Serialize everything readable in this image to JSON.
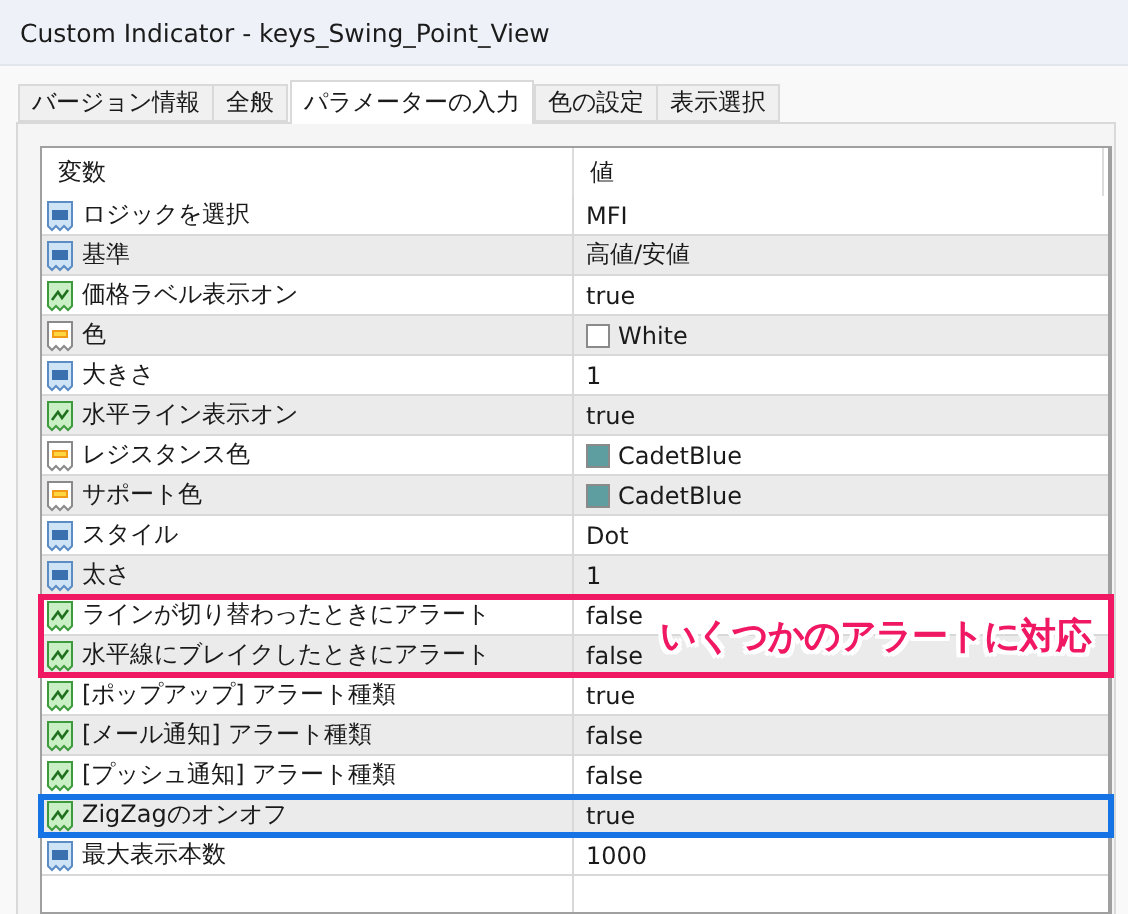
{
  "window": {
    "title": "Custom Indicator - keys_Swing_Point_View"
  },
  "tabs": [
    {
      "label": "バージョン情報",
      "selected": false
    },
    {
      "label": "全般",
      "selected": false
    },
    {
      "label": "パラメーターの入力",
      "selected": true
    },
    {
      "label": "色の設定",
      "selected": false
    },
    {
      "label": "表示選択",
      "selected": false
    }
  ],
  "table": {
    "columns": [
      "変数",
      "値"
    ],
    "groups": [
      {
        "rows": [
          {
            "kind": "int",
            "name": "ロジックを選択",
            "value": "MFI"
          },
          {
            "kind": "int",
            "name": "基準",
            "value": "高値/安値"
          },
          {
            "kind": "bool",
            "name": "価格ラベル表示オン",
            "value": "true"
          },
          {
            "kind": "color",
            "name": "色",
            "value": "White",
            "color": "#ffffff"
          },
          {
            "kind": "int",
            "name": "大きさ",
            "value": "1"
          },
          {
            "kind": "bool",
            "name": "水平ライン表示オン",
            "value": "true"
          },
          {
            "kind": "color",
            "name": "レジスタンス色",
            "value": "CadetBlue",
            "color": "#5f9ea0"
          },
          {
            "kind": "color",
            "name": "サポート色",
            "value": "CadetBlue",
            "color": "#5f9ea0"
          },
          {
            "kind": "int",
            "name": "スタイル",
            "value": "Dot"
          },
          {
            "kind": "int",
            "name": "太さ",
            "value": "1"
          }
        ]
      },
      {
        "frame": {
          "color": "#f01862",
          "label": "いくつかのアラートに対応"
        },
        "rows": [
          {
            "kind": "bool",
            "name": "ラインが切り替わったときにアラート",
            "value": "false"
          },
          {
            "kind": "bool",
            "name": "水平線にブレイクしたときにアラート",
            "value": "false"
          }
        ]
      },
      {
        "rows": [
          {
            "kind": "bool",
            "name": "[ポップアップ] アラート種類",
            "value": "true"
          },
          {
            "kind": "bool",
            "name": "[メール通知] アラート種類",
            "value": "false"
          },
          {
            "kind": "bool",
            "name": "[プッシュ通知] アラート種類",
            "value": "false"
          }
        ]
      },
      {
        "frame": {
          "color": "#1673e6"
        },
        "rows": [
          {
            "kind": "bool",
            "name": "ZigZagのオンオフ",
            "value": "true"
          }
        ]
      },
      {
        "rows": [
          {
            "kind": "int",
            "name": "最大表示本数",
            "value": "1000"
          }
        ]
      }
    ]
  }
}
